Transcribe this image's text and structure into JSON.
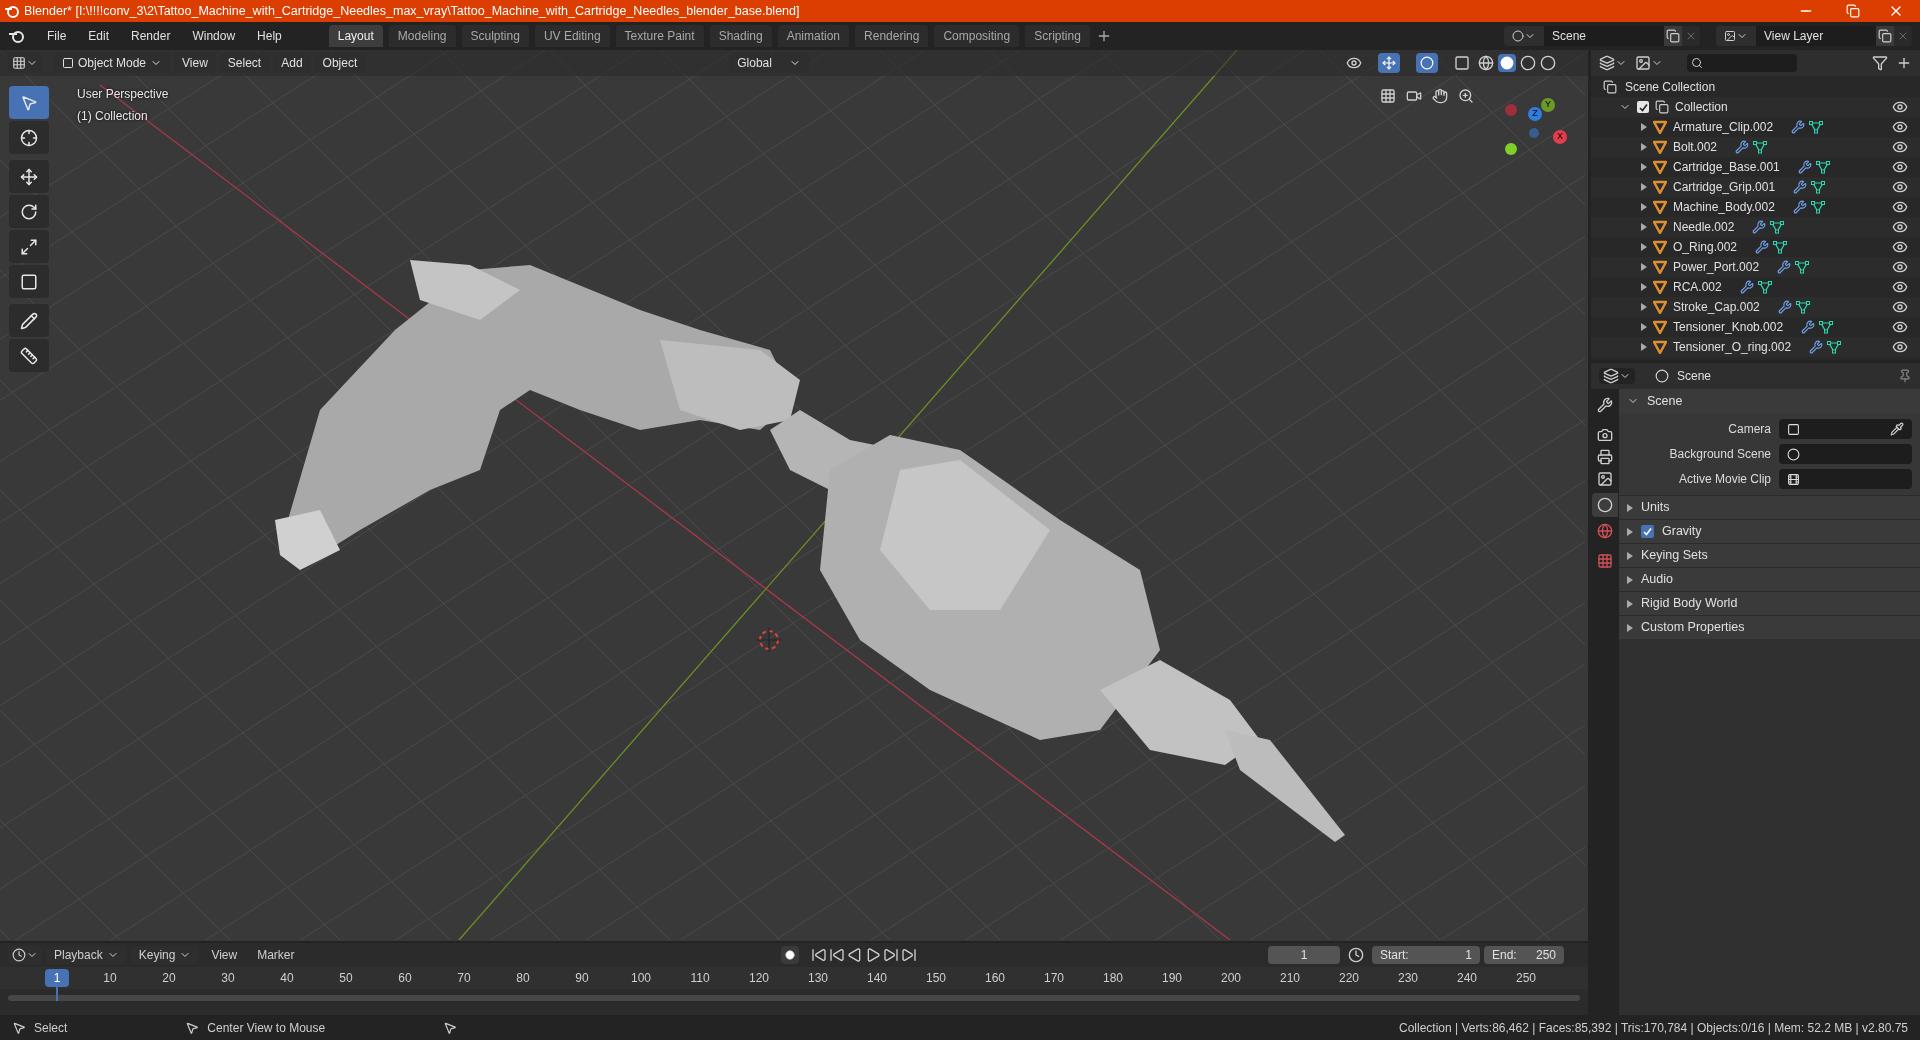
{
  "title_bar": {
    "title": "Blender* [I:\\!!!!conv_3\\2\\Tattoo_Machine_with_Cartridge_Needles_max_vray\\Tattoo_Machine_with_Cartridge_Needles_blender_base.blend]"
  },
  "menu": [
    "File",
    "Edit",
    "Render",
    "Window",
    "Help"
  ],
  "workspaces": [
    {
      "label": "Layout",
      "selected": true
    },
    {
      "label": "Modeling",
      "selected": false
    },
    {
      "label": "Sculpting",
      "selected": false
    },
    {
      "label": "UV Editing",
      "selected": false
    },
    {
      "label": "Texture Paint",
      "selected": false
    },
    {
      "label": "Shading",
      "selected": false
    },
    {
      "label": "Animation",
      "selected": false
    },
    {
      "label": "Rendering",
      "selected": false
    },
    {
      "label": "Compositing",
      "selected": false
    },
    {
      "label": "Scripting",
      "selected": false
    }
  ],
  "scene_field": {
    "value": "Scene"
  },
  "view_layer_field": {
    "value": "View Layer"
  },
  "viewport": {
    "mode": "Object Mode",
    "menus": [
      "View",
      "Select",
      "Add",
      "Object"
    ],
    "orientation": "Global",
    "overlay_text": [
      "User Perspective",
      "(1) Collection"
    ],
    "tools": [
      {
        "kind": "select",
        "selected": true
      },
      {
        "kind": "cursor",
        "selected": false
      },
      {
        "kind": "move",
        "selected": false
      },
      {
        "kind": "rotate",
        "selected": false
      },
      {
        "kind": "scale",
        "selected": false
      },
      {
        "kind": "transform",
        "selected": false
      },
      {
        "kind": "annotate",
        "selected": false
      },
      {
        "kind": "measure",
        "selected": false
      }
    ],
    "gizmo": {
      "z": "Z",
      "y": "Y",
      "x": "X"
    }
  },
  "outliner": {
    "root": "Scene Collection",
    "collection": {
      "name": "Collection",
      "checked": true,
      "expanded": true,
      "children": [
        {
          "name": "Armature_Clip.002"
        },
        {
          "name": "Bolt.002"
        },
        {
          "name": "Cartridge_Base.001"
        },
        {
          "name": "Cartridge_Grip.001"
        },
        {
          "name": "Machine_Body.002"
        },
        {
          "name": "Needle.002"
        },
        {
          "name": "O_Ring.002"
        },
        {
          "name": "Power_Port.002"
        },
        {
          "name": "RCA.002"
        },
        {
          "name": "Stroke_Cap.002"
        },
        {
          "name": "Tensioner_Knob.002"
        },
        {
          "name": "Tensioner_O_ring.002"
        }
      ]
    }
  },
  "properties": {
    "context": "Scene",
    "section": {
      "title": "Scene",
      "expanded": true,
      "fields": [
        {
          "label": "Camera",
          "kind": "camera"
        },
        {
          "label": "Background Scene",
          "kind": "scene"
        },
        {
          "label": "Active Movie Clip",
          "kind": "clip"
        }
      ]
    },
    "panels": [
      {
        "title": "Units",
        "kind": "plain"
      },
      {
        "title": "Gravity",
        "kind": "checkbox",
        "checked": true
      },
      {
        "title": "Keying Sets",
        "kind": "plain"
      },
      {
        "title": "Audio",
        "kind": "plain"
      },
      {
        "title": "Rigid Body World",
        "kind": "plain"
      },
      {
        "title": "Custom Properties",
        "kind": "plain"
      }
    ]
  },
  "timeline": {
    "menus": [
      "Playback",
      "Keying",
      "View",
      "Marker"
    ],
    "current_frame": "1",
    "start_label": "Start:",
    "start": "1",
    "end_label": "End:",
    "end": "250",
    "ticks": [
      {
        "label": "1",
        "selected": true
      },
      {
        "label": "10",
        "selected": false
      },
      {
        "label": "20",
        "selected": false
      },
      {
        "label": "30",
        "selected": false
      },
      {
        "label": "40",
        "selected": false
      },
      {
        "label": "50",
        "selected": false
      },
      {
        "label": "60",
        "selected": false
      },
      {
        "label": "70",
        "selected": false
      },
      {
        "label": "80",
        "selected": false
      },
      {
        "label": "90",
        "selected": false
      },
      {
        "label": "100",
        "selected": false
      },
      {
        "label": "110",
        "selected": false
      },
      {
        "label": "120",
        "selected": false
      },
      {
        "label": "130",
        "selected": false
      },
      {
        "label": "140",
        "selected": false
      },
      {
        "label": "150",
        "selected": false
      },
      {
        "label": "160",
        "selected": false
      },
      {
        "label": "170",
        "selected": false
      },
      {
        "label": "180",
        "selected": false
      },
      {
        "label": "190",
        "selected": false
      },
      {
        "label": "200",
        "selected": false
      },
      {
        "label": "210",
        "selected": false
      },
      {
        "label": "220",
        "selected": false
      },
      {
        "label": "230",
        "selected": false
      },
      {
        "label": "240",
        "selected": false
      },
      {
        "label": "250",
        "selected": false
      }
    ]
  },
  "status_bar": {
    "hints": [
      "Select",
      "Center View to Mouse"
    ],
    "stats": "Collection | Verts:86,462 | Faces:85,392 | Tris:170,784 | Objects:0/16 | Mem: 52.2 MB | v2.80.75"
  }
}
